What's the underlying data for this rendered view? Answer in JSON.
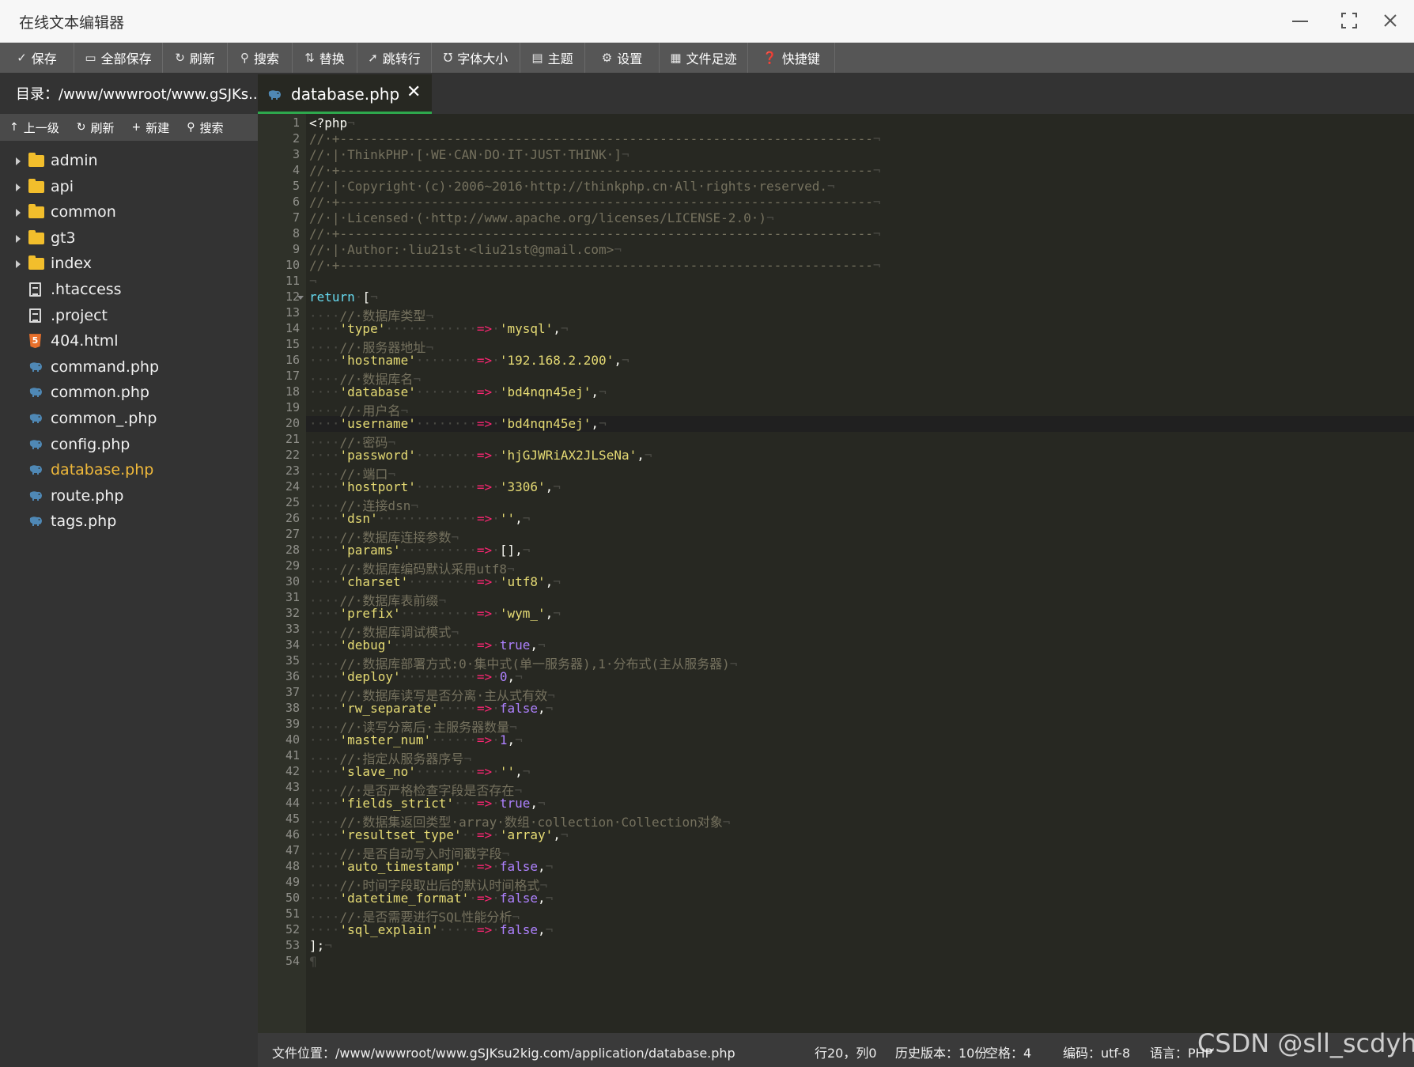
{
  "window": {
    "title": "在线文本编辑器"
  },
  "toolbar": {
    "buttons": [
      {
        "icon": "save-icon",
        "label": "保存"
      },
      {
        "icon": "save-all-icon",
        "label": "全部保存"
      },
      {
        "icon": "refresh-icon",
        "label": "刷新"
      },
      {
        "icon": "search-icon",
        "label": "搜索"
      },
      {
        "icon": "replace-icon",
        "label": "替换"
      },
      {
        "icon": "goto-line-icon",
        "label": "跳转行"
      },
      {
        "icon": "font-size-icon",
        "label": "字体大小"
      },
      {
        "icon": "theme-icon",
        "label": "主题"
      },
      {
        "icon": "settings-icon",
        "label": "设置"
      },
      {
        "icon": "file-history-icon",
        "label": "文件足迹"
      },
      {
        "icon": "help-icon",
        "label": "快捷键"
      }
    ]
  },
  "sidebar": {
    "directory": "目录：/www/wwwroot/www.gSJKs...",
    "tools": [
      {
        "icon": "up-arrow-icon",
        "label": "上一级"
      },
      {
        "icon": "refresh-icon",
        "label": "刷新"
      },
      {
        "icon": "plus-icon",
        "label": "新建"
      },
      {
        "icon": "search-icon",
        "label": "搜索"
      }
    ],
    "items": [
      {
        "type": "folder",
        "name": "admin"
      },
      {
        "type": "folder",
        "name": "api"
      },
      {
        "type": "folder",
        "name": "common"
      },
      {
        "type": "folder",
        "name": "gt3"
      },
      {
        "type": "folder",
        "name": "index"
      },
      {
        "type": "doc",
        "name": ".htaccess"
      },
      {
        "type": "doc",
        "name": ".project"
      },
      {
        "type": "html",
        "name": "404.html"
      },
      {
        "type": "php",
        "name": "command.php"
      },
      {
        "type": "php",
        "name": "common.php"
      },
      {
        "type": "php",
        "name": "common_.php"
      },
      {
        "type": "php",
        "name": "config.php"
      },
      {
        "type": "php",
        "name": "database.php",
        "active": true
      },
      {
        "type": "php",
        "name": "route.php"
      },
      {
        "type": "php",
        "name": "tags.php"
      }
    ]
  },
  "tab": {
    "label": "database.php",
    "close": "✕"
  },
  "editor": {
    "active_line": 20,
    "lines": [
      "<?php",
      "// +----------------------------------------------------------------------",
      "// | ThinkPHP [ WE CAN DO IT JUST THINK ]",
      "// +----------------------------------------------------------------------",
      "// | Copyright (c) 2006~2016 http://thinkphp.cn All rights reserved.",
      "// +----------------------------------------------------------------------",
      "// | Licensed ( http://www.apache.org/licenses/LICENSE-2.0 )",
      "// +----------------------------------------------------------------------",
      "// | Author: liu21st <liu21st@gmail.com>",
      "// +----------------------------------------------------------------------",
      "",
      "return [",
      "    // 数据库类型",
      "    'type'            => 'mysql',",
      "    // 服务器地址",
      "    'hostname'        => '192.168.2.200',",
      "    // 数据库名",
      "    'database'        => 'bd4nqn45ej',",
      "    // 用户名",
      "    'username'        => 'bd4nqn45ej',",
      "    // 密码",
      "    'password'        => 'hjGJWRiAX2JLSeNa',",
      "    // 端口",
      "    'hostport'        => '3306',",
      "    // 连接dsn",
      "    'dsn'             => '',",
      "    // 数据库连接参数",
      "    'params'          => [],",
      "    // 数据库编码默认采用utf8",
      "    'charset'         => 'utf8',",
      "    // 数据库表前缀",
      "    'prefix'          => 'wym_',",
      "    // 数据库调试模式",
      "    'debug'           => true,",
      "    // 数据库部署方式:0 集中式(单一服务器),1 分布式(主从服务器)",
      "    'deploy'          => 0,",
      "    // 数据库读写是否分离 主从式有效",
      "    'rw_separate'     => false,",
      "    // 读写分离后 主服务器数量",
      "    'master_num'      => 1,",
      "    // 指定从服务器序号",
      "    'slave_no'        => '',",
      "    // 是否严格检查字段是否存在",
      "    'fields_strict'   => true,",
      "    // 数据集返回类型 array 数组 collection Collection对象",
      "    'resultset_type'  => 'array',",
      "    // 是否自动写入时间戳字段",
      "    'auto_timestamp'  => false,",
      "    // 时间字段取出后的默认时间格式",
      "    'datetime_format' => false,",
      "    // 是否需要进行SQL性能分析",
      "    'sql_explain'     => false,",
      "];",
      ""
    ]
  },
  "status": {
    "file_location": "文件位置：/www/wwwroot/www.gSJKsu2kig.com/application/database.php",
    "cursor": "行20，列0",
    "history": "历史版本：10份",
    "indent": "空格：4",
    "encoding": "编码：utf-8",
    "language": "语言：PHP"
  },
  "watermark": "CSDN @sll_scdyh",
  "colors": {
    "accent_tab": "#2ea84d",
    "active_file": "#f0b93a",
    "folder": "#f2be2c"
  }
}
